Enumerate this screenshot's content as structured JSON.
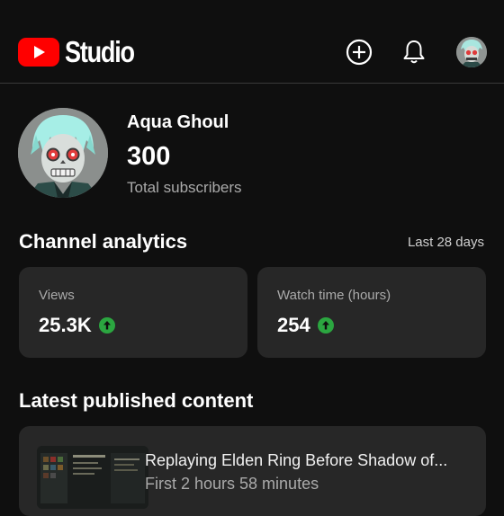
{
  "header": {
    "logo_text": "Studio",
    "brand_color": "#ff0000",
    "icons": [
      "create-icon",
      "notifications-icon",
      "account-avatar"
    ]
  },
  "channel": {
    "name": "Aqua Ghoul",
    "subscriber_count": "300",
    "subscriber_label": "Total subscribers"
  },
  "analytics": {
    "title": "Channel analytics",
    "period": "Last 28 days",
    "cards": [
      {
        "label": "Views",
        "value": "25.3K",
        "trend": "up",
        "trend_color": "#2ba640"
      },
      {
        "label": "Watch time (hours)",
        "value": "254",
        "trend": "up",
        "trend_color": "#2ba640"
      }
    ]
  },
  "latest": {
    "title": "Latest published content",
    "items": [
      {
        "title": "Replaying Elden Ring Before Shadow of...",
        "meta": "First 2 hours 58 minutes"
      }
    ]
  }
}
